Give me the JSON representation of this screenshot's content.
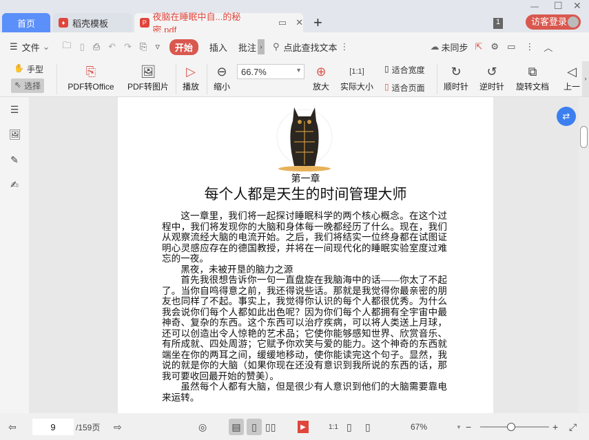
{
  "tabs": {
    "home": "首页",
    "template": "稻壳模板",
    "document": "夜脑在睡眠中自...的秘密.pdf"
  },
  "window": {
    "badge": "1",
    "login": "访客登录"
  },
  "toolbar": {
    "file": "文件",
    "tabs": [
      "开始",
      "插入",
      "批注"
    ],
    "search": "点此查找文本",
    "sync": "未同步"
  },
  "ribbon": {
    "hand": "手型",
    "select": "选择",
    "pdf_office": "PDF转Office",
    "pdf_image": "PDF转图片",
    "play": "播放",
    "zoom_out": "缩小",
    "zoom_value": "66.7%",
    "zoom_in": "放大",
    "actual": "实际大小",
    "fit_width": "适合宽度",
    "fit_page": "适合页面",
    "cw": "顺时针",
    "ccw": "逆时针",
    "rotate": "旋转文档",
    "prev": "上一"
  },
  "document": {
    "chapter": "第一章",
    "title": "每个人都是天生的时间管理大师",
    "paragraphs": [
      "这一章里，我们将一起探讨睡眠科学的两个核心概念。在这个过程中，我们将发现你的大脑和身体每一晚都经历了什么。现在，我们从观察流经大脑的电流开始。之后，我们将结实一位终身都在试图证明心灵感应存在的德国教授，并将在一间现代化的睡眠实验室度过难忘的一夜。",
      "黑夜，未被开垦的脑力之源",
      "首先我很想告诉你一句一直盘旋在我脑海中的话——你太了不起了。当你自鸣得意之前，我还得说些话。那就是我觉得你最亲密的朋友也同样了不起。事实上，我觉得你认识的每个人都很优秀。为什么我会说你们每个人都如此出色呢？因为你们每个人都拥有全宇宙中最神奇、复杂的东西。这个东西可以治疗疾病，可以将人类送上月球，还可以创造出令人惊艳的艺术品；它使你能够感知世界、欣赏音乐、有所成就、四处周游；它赋予你欢笑与爱的能力。这个神奇的东西就端坐在你的两耳之间，缓缓地移动，使你能读完这个句子。显然，我说的就是你的大脑（如果你现在还没有意识到我所说的东西的话，那我可要收回最开始的赞美）。",
      "虽然每个人都有大脑，但是很少有人意识到他们的大脑需要靠电来运转。"
    ]
  },
  "status": {
    "page": "9",
    "total": "/159页",
    "zoom": "67%",
    "zoom_fraction": 0.45
  }
}
